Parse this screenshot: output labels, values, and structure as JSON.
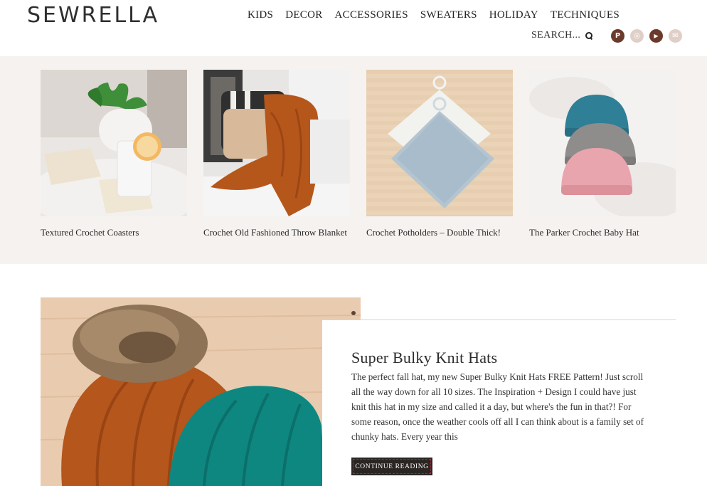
{
  "site": {
    "logo": "SEWRELLA"
  },
  "nav": {
    "items": [
      "KIDS",
      "DECOR",
      "ACCESSORIES",
      "SWEATERS",
      "HOLIDAY",
      "TECHNIQUES"
    ],
    "search_label": "SEARCH...",
    "social": [
      {
        "icon": "pinterest-icon",
        "glyph": "P",
        "color": "#6b3a2a"
      },
      {
        "icon": "instagram-icon",
        "glyph": "◎",
        "color": "#e0cfc8"
      },
      {
        "icon": "youtube-icon",
        "glyph": "▶",
        "color": "#6b3a2a"
      },
      {
        "icon": "email-icon",
        "glyph": "✉",
        "color": "#e0cfc8"
      }
    ]
  },
  "related": [
    {
      "title": "Textured Crochet Coasters"
    },
    {
      "title": "Crochet Old Fashioned Throw Blanket"
    },
    {
      "title": "Crochet Potholders – Double Thick!"
    },
    {
      "title": "The Parker Crochet Baby Hat"
    }
  ],
  "post": {
    "title": "Super Bulky Knit Hats",
    "excerpt": "The perfect fall hat, my new Super Bulky Knit Hats FREE Pattern! Just scroll all the way down for all 10 sizes. The Inspiration + Design I could have just knit this hat in my size and called it a day, but where's the fun in that?! For some reason, once the weather cools off all I can think about is a family set of chunky hats. Every year this",
    "button": "CONTINUE READING"
  },
  "colors": {
    "band_bg": "#f6f2f0",
    "button_bg": "#2b2624",
    "brand_brown": "#6b3a2a"
  }
}
